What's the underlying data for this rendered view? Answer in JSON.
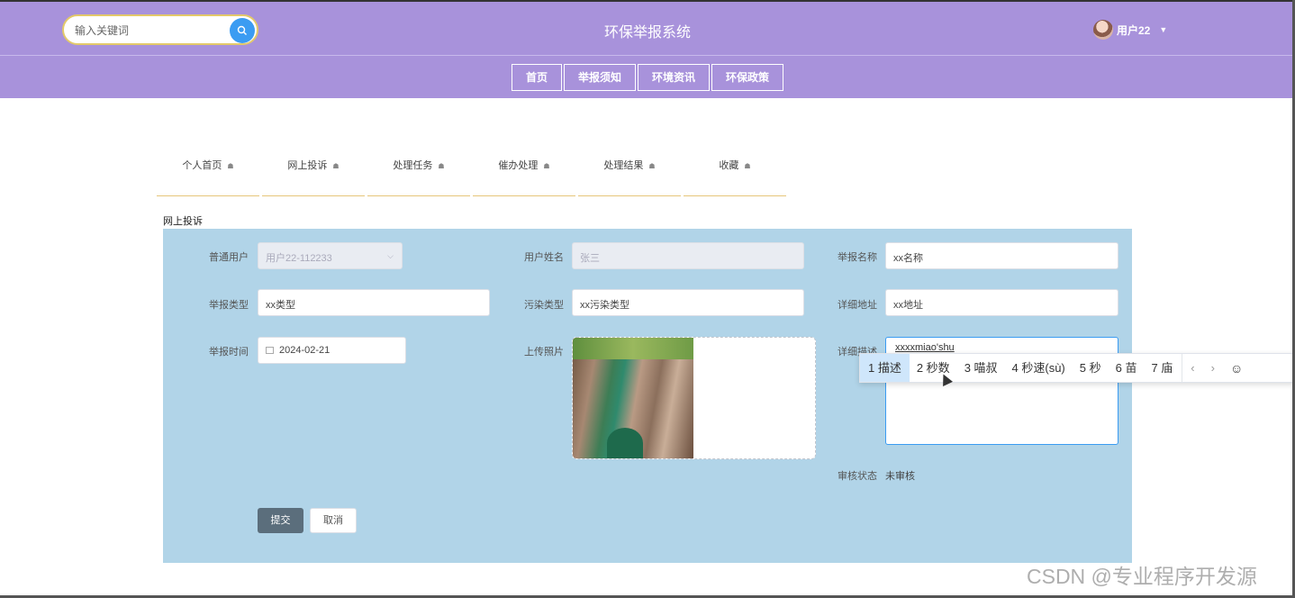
{
  "header": {
    "search_placeholder": "输入关键词",
    "title": "环保举报系统",
    "username": "用户22"
  },
  "nav": {
    "items": [
      {
        "label": "首页"
      },
      {
        "label": "举报须知"
      },
      {
        "label": "环境资讯"
      },
      {
        "label": "环保政策"
      }
    ]
  },
  "tabs": {
    "items": [
      {
        "label": "个人首页"
      },
      {
        "label": "网上投诉"
      },
      {
        "label": "处理任务"
      },
      {
        "label": "催办处理"
      },
      {
        "label": "处理结果"
      },
      {
        "label": "收藏"
      }
    ]
  },
  "form": {
    "section_title": "网上投诉",
    "user_label": "普通用户",
    "user_value": "用户22-112233",
    "name_label": "用户姓名",
    "name_value": "张三",
    "report_name_label": "举报名称",
    "report_name_value": "xx名称",
    "report_type_label": "举报类型",
    "report_type_value": "xx类型",
    "pollution_type_label": "污染类型",
    "pollution_type_value": "xx污染类型",
    "address_label": "详细地址",
    "address_value": "xx地址",
    "time_label": "举报时间",
    "time_value": "2024-02-21",
    "photo_label": "上传照片",
    "desc_label": "详细描述",
    "desc_value": "xxxxmiao'shu",
    "status_label": "审核状态",
    "status_value": "未审核",
    "submit_label": "提交",
    "cancel_label": "取消"
  },
  "ime": {
    "candidates": [
      {
        "text": "1 描述"
      },
      {
        "text": "2 秒数"
      },
      {
        "text": "3 喵叔"
      },
      {
        "text": "4 秒速(sù)"
      },
      {
        "text": "5 秒"
      },
      {
        "text": "6 苗"
      },
      {
        "text": "7 庙"
      }
    ],
    "prev": "‹",
    "next": "›",
    "emoji": "☺"
  },
  "watermark": "CSDN @专业程序开发源",
  "colors": {
    "header_bg": "#a892db",
    "panel_bg": "#b1d4e8",
    "search_btn": "#3b9cf2",
    "submit_btn": "#5b6e7c"
  }
}
